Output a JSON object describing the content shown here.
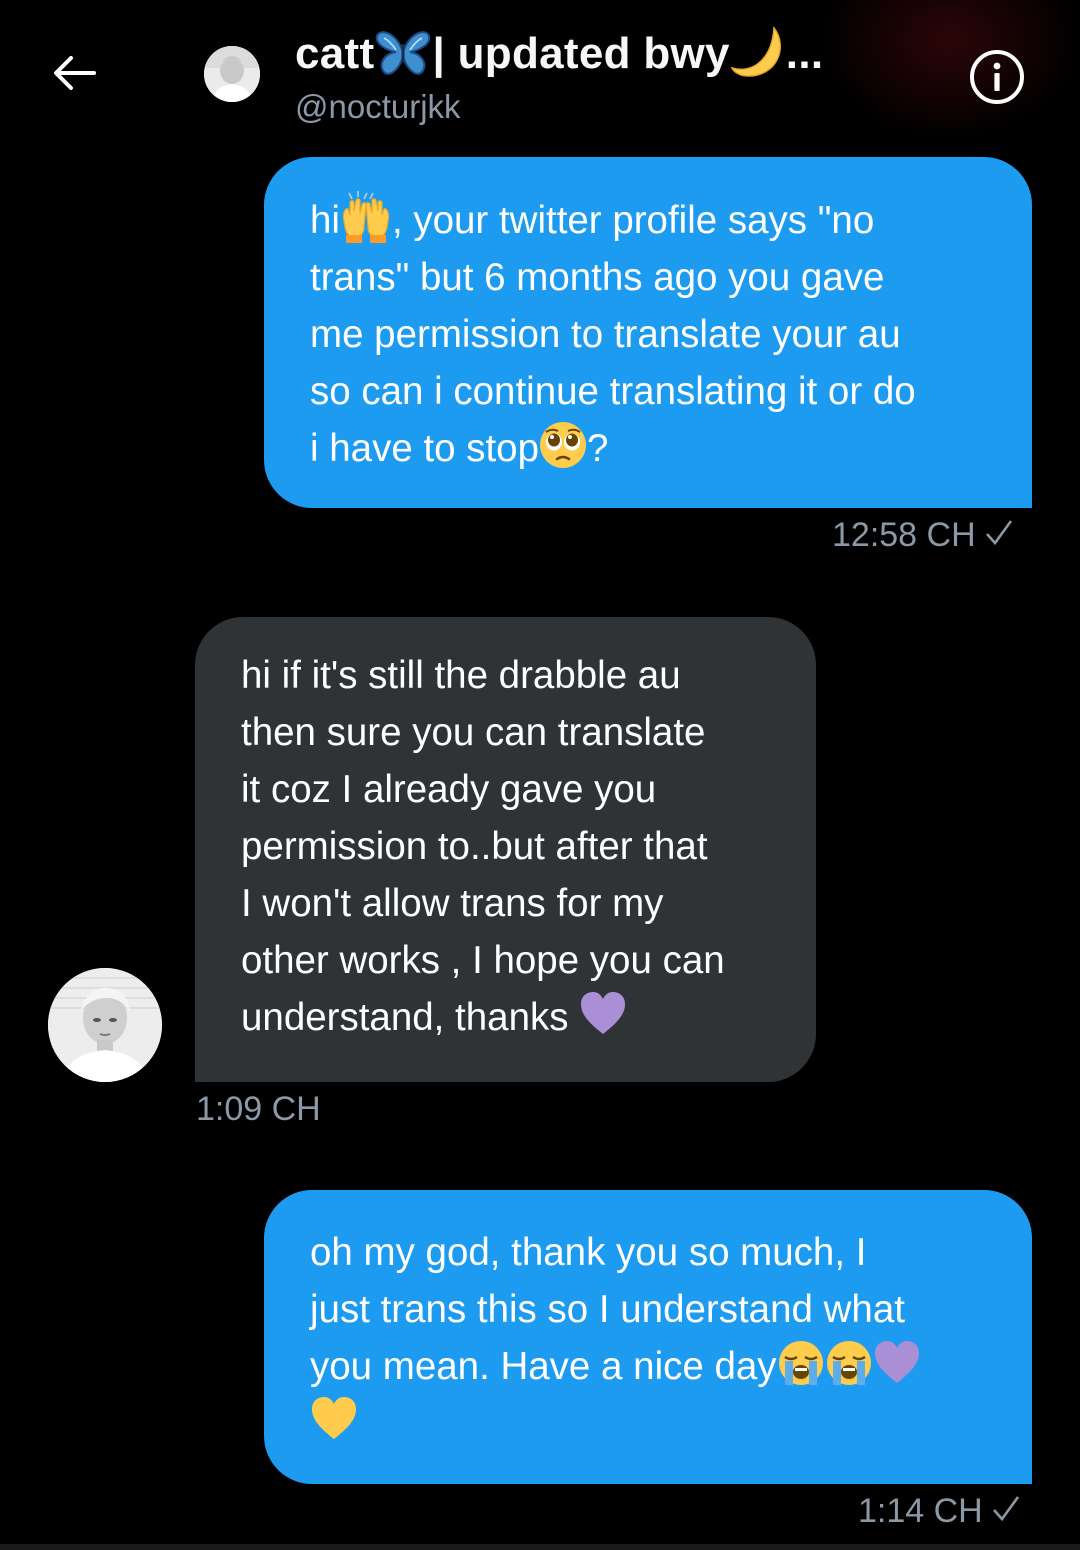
{
  "header": {
    "back_icon": "arrow-left-icon",
    "title_prefix": "catt",
    "title_middle": "| updated bwy",
    "title_suffix": " ...",
    "handle": "@nocturjkk",
    "info_icon": "info-icon"
  },
  "messages": [
    {
      "direction": "sent",
      "lines": [
        {
          "a": "hi",
          "emoji": "raising-hands-emoji",
          "b": ", your twitter profile says \"no"
        },
        {
          "a": "trans\" but 6 months ago you gave"
        },
        {
          "a": "me permission to translate your au"
        },
        {
          "a": "so can i continue translating it or do"
        },
        {
          "a": "i have to stop",
          "emoji": "pleading-face-emoji",
          "b": "?"
        }
      ],
      "time": "12:58 CH"
    },
    {
      "direction": "received",
      "lines": [
        {
          "a": "hi if it's still the drabble au"
        },
        {
          "a": "then sure you can translate"
        },
        {
          "a": "it coz I already gave you"
        },
        {
          "a": "permission to..but after that"
        },
        {
          "a": "I won't allow trans for my"
        },
        {
          "a": "other works , I hope you can"
        },
        {
          "a": "understand, thanks "
        }
      ],
      "time": "1:09 CH"
    },
    {
      "direction": "sent",
      "lines": [
        {
          "a": "oh my god, thank you so much, I"
        },
        {
          "a": "just trans this so I understand what"
        },
        {
          "a": "you mean. Have a nice day"
        }
      ],
      "time": "1:14 CH"
    }
  ],
  "colors": {
    "sent_bubble": "#1d9bf0",
    "received_bubble": "#2f3336",
    "secondary_text": "#8b98a5",
    "background": "#000000"
  }
}
